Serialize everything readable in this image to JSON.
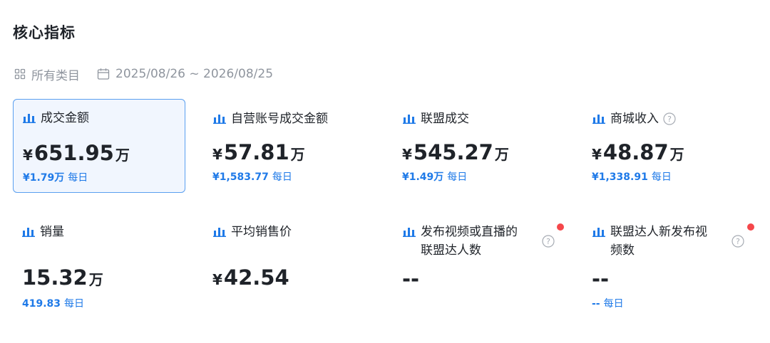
{
  "header": {
    "title": "核心指标"
  },
  "filters": {
    "category": "所有类目",
    "date_range": "2025/08/26 ~ 2026/08/25",
    "category_icon": "grid-icon",
    "date_icon": "calendar-icon"
  },
  "colors": {
    "accent": "#1f7ae8",
    "selected_bg": "#f1f6fe",
    "selected_border": "#5a9ff0",
    "red_dot": "#f5474a"
  },
  "metrics": [
    {
      "label": "成交金额",
      "currency": "¥",
      "value": "651.95",
      "unit": "万",
      "daily_value": "¥1.79万",
      "daily_label": "每日",
      "selected": true
    },
    {
      "label": "自营账号成交金额",
      "currency": "¥",
      "value": "57.81",
      "unit": "万",
      "daily_value": "¥1,583.77",
      "daily_label": "每日"
    },
    {
      "label": "联盟成交",
      "currency": "¥",
      "value": "545.27",
      "unit": "万",
      "daily_value": "¥1.49万",
      "daily_label": "每日"
    },
    {
      "label": "商城收入",
      "currency": "¥",
      "value": "48.87",
      "unit": "万",
      "daily_value": "¥1,338.91",
      "daily_label": "每日",
      "help": true
    },
    {
      "label": "销量",
      "value": "15.32",
      "unit": "万",
      "daily_value": "419.83",
      "daily_label": "每日"
    },
    {
      "label": "平均销售价",
      "currency": "¥",
      "value": "42.54"
    },
    {
      "label": "发布视频或直播的联盟达人数",
      "value": "--",
      "help": true,
      "new_dot": true
    },
    {
      "label": "联盟达人新发布视频数",
      "value": "--",
      "daily_value": "--",
      "daily_label": "每日",
      "help": true,
      "new_dot": true
    }
  ]
}
